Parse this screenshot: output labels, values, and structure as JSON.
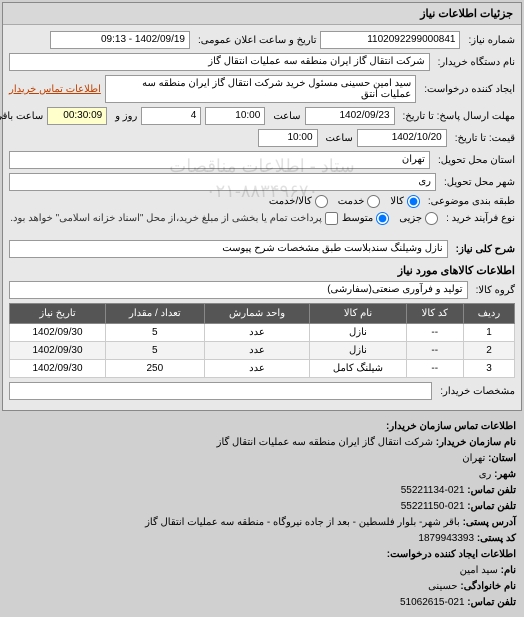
{
  "panel_title": "جزئیات اطلاعات نیاز",
  "fields": {
    "req_number_label": "شماره نیاز:",
    "req_number": "1102092299000841",
    "announce_label": "تاریخ و ساعت اعلان عمومی:",
    "announce_value": "1402/09/19 - 09:13",
    "buyer_org_label": "نام دستگاه خریدار:",
    "buyer_org": "شرکت انتقال گاز ایران منطقه سه عملیات انتقال گاز",
    "requester_label": "ایجاد کننده درخواست:",
    "requester": "سید امین حسینی مسئول خرید شرکت انتقال گاز ایران منطقه سه عملیات انتق",
    "buyer_contact_link": "اطلاعات تماس خریدار",
    "deadline_label": "مهلت ارسال پاسخ: تا تاریخ:",
    "deadline_date": "1402/09/23",
    "time_label": "ساعت",
    "deadline_time": "10:00",
    "days_left": "4",
    "day_word": "روز و",
    "time_left": "00:30:09",
    "time_left_label": "ساعت باقی مانده",
    "valid_until_label": "قیمت: تا تاریخ:",
    "valid_until_date": "1402/10/20",
    "valid_until_time": "10:00",
    "province_label": "استان محل تحویل:",
    "province": "تهران",
    "city_label": "شهر محل تحویل:",
    "city": "ری",
    "category_label": "طبقه بندی موضوعی:",
    "category_opts": {
      "goods": "کالا",
      "service": "خدمت",
      "both": "کالا/خدمت"
    },
    "process_label": "نوع فرآیند خرید :",
    "process_opts": {
      "low": "جزیی",
      "mid": "متوسط"
    },
    "process_note": "پرداخت تمام یا بخشی از مبلغ خرید،از محل \"اسناد خزانه اسلامی\" خواهد بود.",
    "desc_label": "شرح کلی نیاز:",
    "desc": "نازل وشیلنگ سندبلاست طبق مشخصات شرح پیوست",
    "items_section": "اطلاعات کالاهای مورد نیاز",
    "group_label": "گروه کالا:",
    "group": "تولید و فرآوری صنعتی(سفارشی)",
    "items_label": "مشخصات خریدار:"
  },
  "table": {
    "headers": [
      "ردیف",
      "کد کالا",
      "نام کالا",
      "واحد شمارش",
      "تعداد / مقدار",
      "تاریخ نیاز"
    ],
    "rows": [
      {
        "n": "1",
        "code": "--",
        "name": "نازل",
        "unit": "عدد",
        "qty": "5",
        "date": "1402/09/30"
      },
      {
        "n": "2",
        "code": "--",
        "name": "نازل",
        "unit": "عدد",
        "qty": "5",
        "date": "1402/09/30"
      },
      {
        "n": "3",
        "code": "--",
        "name": "شیلنگ کامل",
        "unit": "عدد",
        "qty": "250",
        "date": "1402/09/30"
      }
    ]
  },
  "watermark": {
    "line1": "ستاد - اطلاعات مناقصات",
    "line2": "۰۲۱-۸۸۳۴۹۶۷۰"
  },
  "footer": {
    "heading1": "اطلاعات تماس سازمان خریدار:",
    "org_name_label": "نام سازمان خریدار:",
    "org_name": "شرکت انتقال گاز ایران منطقه سه عملیات انتقال گاز",
    "province_label": "استان:",
    "province": "تهران",
    "city_label": "شهر:",
    "city": "ری",
    "phone_label": "تلفن تماس:",
    "phone": "021-55221134",
    "fax_label": "تلفن تماس:",
    "fax": "021-55221150",
    "address_label": "آدرس پستی:",
    "address": "باقر شهر- بلوار فلسطین - بعد از جاده نیروگاه - منطقه سه عملیات انتقال گاز",
    "postcode_label": "کد پستی:",
    "postcode": "1879943393",
    "heading2": "اطلاعات ایجاد کننده درخواست:",
    "fname_label": "نام:",
    "fname": "سید امین",
    "lname_label": "نام خانوادگی:",
    "lname": "حسینی",
    "contact_phone_label": "تلفن تماس:",
    "contact_phone": "021-51062615"
  }
}
